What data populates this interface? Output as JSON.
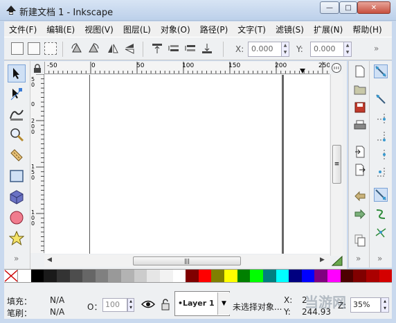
{
  "window": {
    "title": "新建文档 1 - Inkscape",
    "minimize": "—",
    "maximize": "□",
    "close": "✕"
  },
  "menu": [
    "文件(F)",
    "编辑(E)",
    "视图(V)",
    "图层(L)",
    "对象(O)",
    "路径(P)",
    "文字(T)",
    "滤镜(S)",
    "扩展(N)",
    "帮助(H)"
  ],
  "toolbar": {
    "x_label": "X:",
    "x_value": "0.000",
    "y_label": "Y:",
    "y_value": "0.000",
    "more": "»"
  },
  "ruler": {
    "h_ticks": [
      "-50",
      "0",
      "50",
      "100",
      "150",
      "200",
      "250"
    ],
    "v_ticks": [
      "5 0",
      "0",
      "2 0 0",
      "1 5 0",
      "1 0 0"
    ]
  },
  "scroll": {
    "h_thumb": "|||",
    "v_thumb": "≡"
  },
  "palette": [
    "#ffffff",
    "#000000",
    "#1a1a1a",
    "#333333",
    "#4d4d4d",
    "#666666",
    "#808080",
    "#999999",
    "#b3b3b3",
    "#cccccc",
    "#e6e6e6",
    "#f2f2f2",
    "#ffffff",
    "#800000",
    "#ff0000",
    "#808000",
    "#ffff00",
    "#008000",
    "#00ff00",
    "#008080",
    "#00ffff",
    "#000080",
    "#0000ff",
    "#800080",
    "#ff00ff",
    "#4d0000",
    "#800000",
    "#aa0000",
    "#d40000"
  ],
  "status": {
    "fill_label": "填充：",
    "fill_value": "N/A",
    "stroke_label": "笔刷：",
    "stroke_value": "N/A",
    "opacity_label": "O：",
    "opacity_value": "100",
    "layer": "•Layer 1",
    "message": "未选择对象...",
    "x_label": "X:",
    "x_value": "2",
    "y_label": "Y:",
    "y_value": "244.93",
    "zoom_label": "Z:",
    "zoom_value": "35%"
  },
  "watermark": "当游网"
}
